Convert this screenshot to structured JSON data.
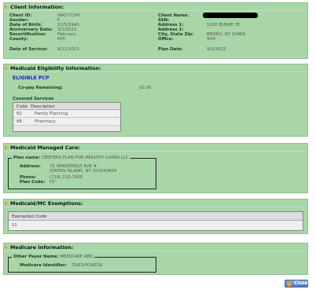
{
  "client": {
    "title": "Client Information:",
    "left": [
      {
        "label": "Client ID:",
        "value": "WA57724Y"
      },
      {
        "label": "Gender:",
        "value": "F"
      },
      {
        "label": "Date of Birth:",
        "value": "12/5/1940"
      },
      {
        "label": "Anniversary Date:",
        "value": "3/1/2023"
      },
      {
        "label": "Recertification:",
        "value": "February"
      },
      {
        "label": "County:",
        "value": "NYC"
      }
    ],
    "right": [
      {
        "label": "Client Name:",
        "value": ""
      },
      {
        "label": "SSN:",
        "value": ""
      },
      {
        "label": "Address 1:",
        "value": "1260 BURKE TE"
      },
      {
        "label": "Address 2:",
        "value": ""
      },
      {
        "label": "City, State Zip:",
        "value": "BRONX, NY 10469"
      },
      {
        "label": "Office:",
        "value": "SH9"
      }
    ],
    "service_label": "Date of Service:",
    "service_value": "9/11/2023",
    "plan_date_label": "Plan Date:",
    "plan_date_value": "9/1/2023"
  },
  "eligibility": {
    "title": "Medicaid Eligibility Information:",
    "status": "ELIGIBLE PCP",
    "copay_label": "Co-pay Remaining:",
    "copay_value": "$0.00",
    "covered_title": "Covered Services",
    "columns": [
      "Code",
      "Description"
    ],
    "rows": [
      {
        "code": "82",
        "description": "Family Planning"
      },
      {
        "code": "88",
        "description": "Pharmacy"
      }
    ]
  },
  "managed_care": {
    "title": "Medicaid Managed Care:",
    "plan_label": "Plan name:",
    "plan_value": "CENTERS PLAN FOR HEALTHY LIVING LLC",
    "address_label": "Address:",
    "address_line1": "75 VANDERBILT AVE #",
    "address_line2": "STATEN ISLAND, NY 103043604",
    "phone_label": "Phone:",
    "phone_value": "(718) 215-7000",
    "plancode_label": "Plan Code:",
    "plancode_value": "CP"
  },
  "exemptions": {
    "title": "Medicaid/MC Exemptions:",
    "column": "Exemption Code",
    "rows": [
      "S1"
    ]
  },
  "medicare": {
    "title": "Medicare Information:",
    "payer_label": "Other Payer Name:",
    "payer_value": "MEDICARE ABD",
    "id_label": "Medicare Identifier:",
    "id_value": "7GR1HY2KP18"
  },
  "close_label": "Close",
  "colors": {
    "panel": "#a8d6a8",
    "accent_triangle": "#e8a31a",
    "eligible_text": "#1c1cc8"
  }
}
